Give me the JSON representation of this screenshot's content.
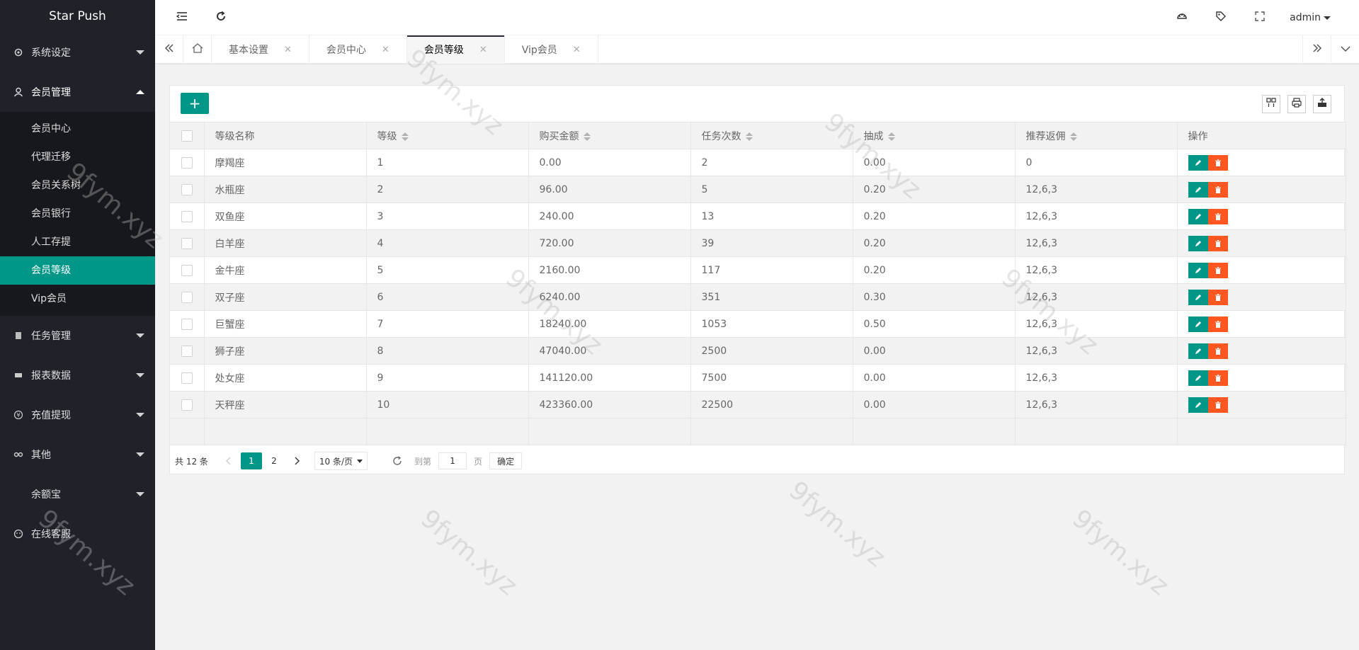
{
  "app": {
    "logo": "Star Push"
  },
  "header": {
    "user": "admin"
  },
  "sidebar": {
    "groups": [
      {
        "label": "系统设定",
        "icon": "gear-icon"
      },
      {
        "label": "会员管理",
        "icon": "user-icon",
        "open": true,
        "items": [
          {
            "label": "会员中心"
          },
          {
            "label": "代理迁移"
          },
          {
            "label": "会员关系树"
          },
          {
            "label": "会员银行"
          },
          {
            "label": "人工存提"
          },
          {
            "label": "会员等级",
            "active": true
          },
          {
            "label": "Vip会员"
          }
        ]
      },
      {
        "label": "任务管理",
        "icon": "file-icon"
      },
      {
        "label": "报表数据",
        "icon": "chart-icon"
      },
      {
        "label": "充值提现",
        "icon": "yen-icon"
      },
      {
        "label": "其他",
        "icon": "link-icon"
      },
      {
        "label": "余额宝",
        "icon": ""
      },
      {
        "label": "在线客服",
        "icon": "face-icon"
      }
    ]
  },
  "tabs": [
    {
      "label": "基本设置"
    },
    {
      "label": "会员中心"
    },
    {
      "label": "会员等级",
      "active": true
    },
    {
      "label": "Vip会员"
    }
  ],
  "table": {
    "columns": [
      "等级名称",
      "等级",
      "购买金额",
      "任务次数",
      "抽成",
      "推荐返佣",
      "操作"
    ],
    "rows": [
      [
        "摩羯座",
        "1",
        "0.00",
        "2",
        "0.00",
        "0"
      ],
      [
        "水瓶座",
        "2",
        "96.00",
        "5",
        "0.20",
        "12,6,3"
      ],
      [
        "双鱼座",
        "3",
        "240.00",
        "13",
        "0.20",
        "12,6,3"
      ],
      [
        "白羊座",
        "4",
        "720.00",
        "39",
        "0.20",
        "12,6,3"
      ],
      [
        "金牛座",
        "5",
        "2160.00",
        "117",
        "0.20",
        "12,6,3"
      ],
      [
        "双子座",
        "6",
        "6240.00",
        "351",
        "0.30",
        "12,6,3"
      ],
      [
        "巨蟹座",
        "7",
        "18240.00",
        "1053",
        "0.50",
        "12,6,3"
      ],
      [
        "狮子座",
        "8",
        "47040.00",
        "2500",
        "0.00",
        "12,6,3"
      ],
      [
        "处女座",
        "9",
        "141120.00",
        "7500",
        "0.00",
        "12,6,3"
      ],
      [
        "天秤座",
        "10",
        "423360.00",
        "22500",
        "0.00",
        "12,6,3"
      ]
    ]
  },
  "pager": {
    "count": "共 12 条",
    "pages": [
      "1",
      "2"
    ],
    "limit": "10 条/页",
    "goto_label": "到第",
    "goto_value": "1",
    "page_unit": "页",
    "confirm": "确定"
  },
  "watermark": "9fym.xyz"
}
